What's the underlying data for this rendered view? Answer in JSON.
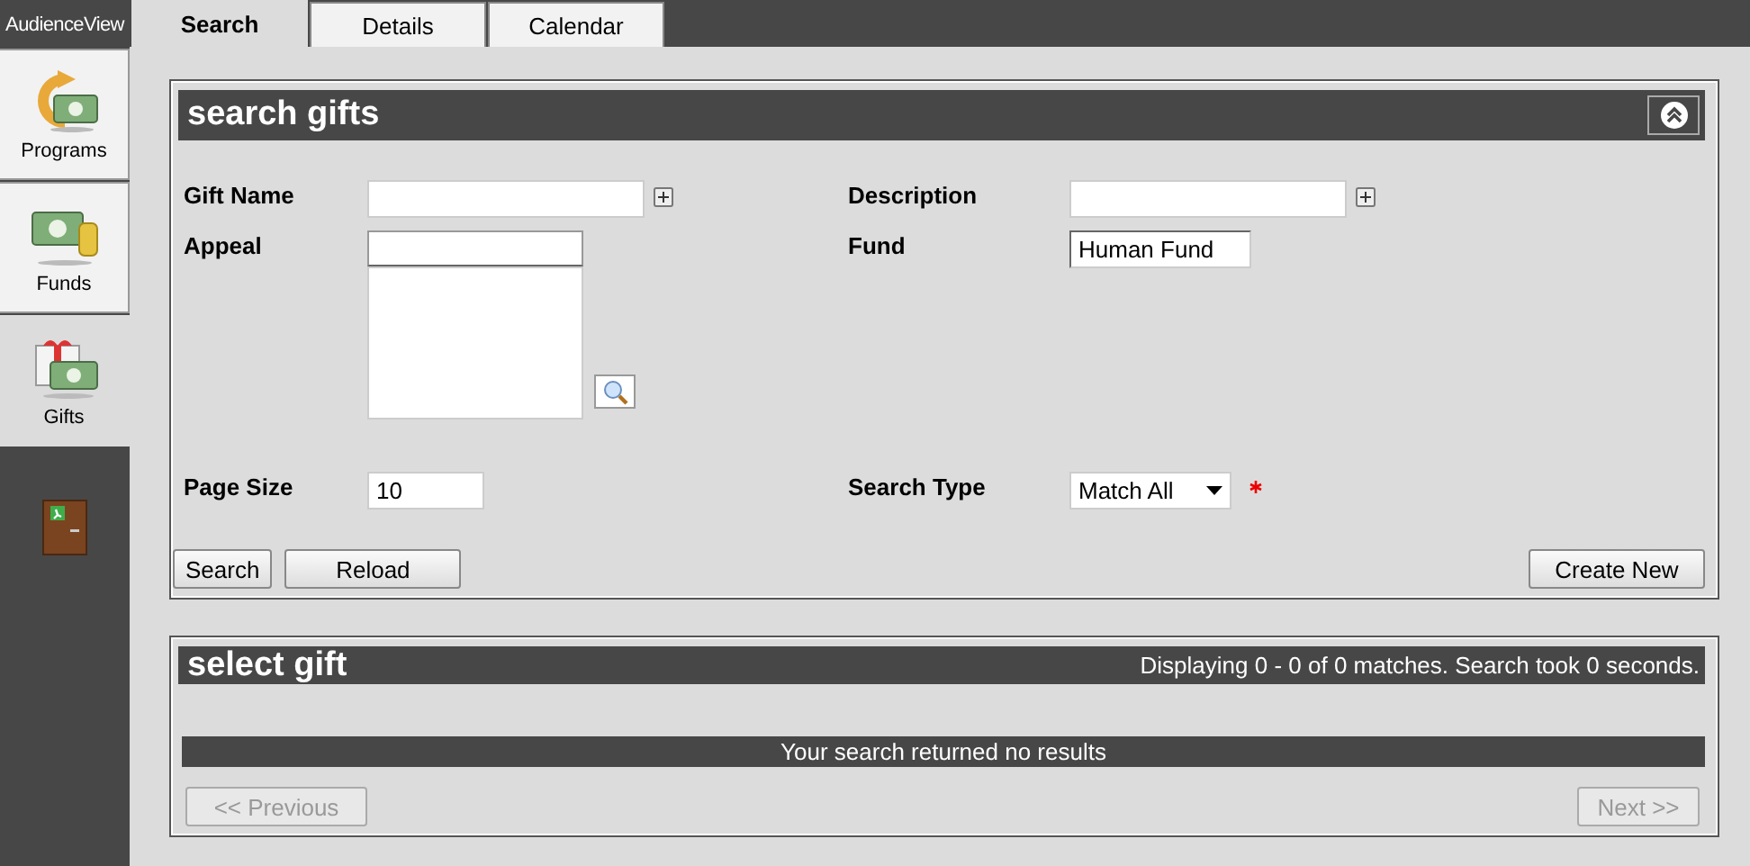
{
  "app": {
    "logo": "AudienceView"
  },
  "sidebar": {
    "items": [
      {
        "label": "Programs",
        "kind": "programs",
        "selected": false
      },
      {
        "label": "Funds",
        "kind": "funds",
        "selected": false
      },
      {
        "label": "Gifts",
        "kind": "gifts",
        "selected": true
      }
    ]
  },
  "tabs": [
    {
      "label": "Search",
      "selected": true
    },
    {
      "label": "Details",
      "selected": false
    },
    {
      "label": "Calendar",
      "selected": false
    }
  ],
  "search_panel": {
    "title": "search gifts",
    "fields": [
      {
        "label": "Gift Name",
        "kind": "text-add"
      },
      {
        "label": "Description",
        "kind": "text-add"
      },
      {
        "label": "Appeal",
        "kind": "lookup"
      },
      {
        "label": "Fund",
        "kind": "text",
        "value": "Human Fund"
      },
      {
        "label": "Page Size",
        "kind": "text",
        "value": "10"
      },
      {
        "label": "Search Type",
        "kind": "select",
        "value": "Match All",
        "required": true
      }
    ],
    "buttons_left": [
      "Search",
      "Reload"
    ],
    "buttons_right": [
      "Create New"
    ]
  },
  "results_panel": {
    "title": "select gift",
    "status": "Displaying 0 - 0 of 0 matches. Search took 0 seconds.",
    "message": "Your search returned no results",
    "previous": {
      "label": "<< Previous",
      "disabled": true
    },
    "next": {
      "label": "Next >>",
      "disabled": true
    }
  }
}
